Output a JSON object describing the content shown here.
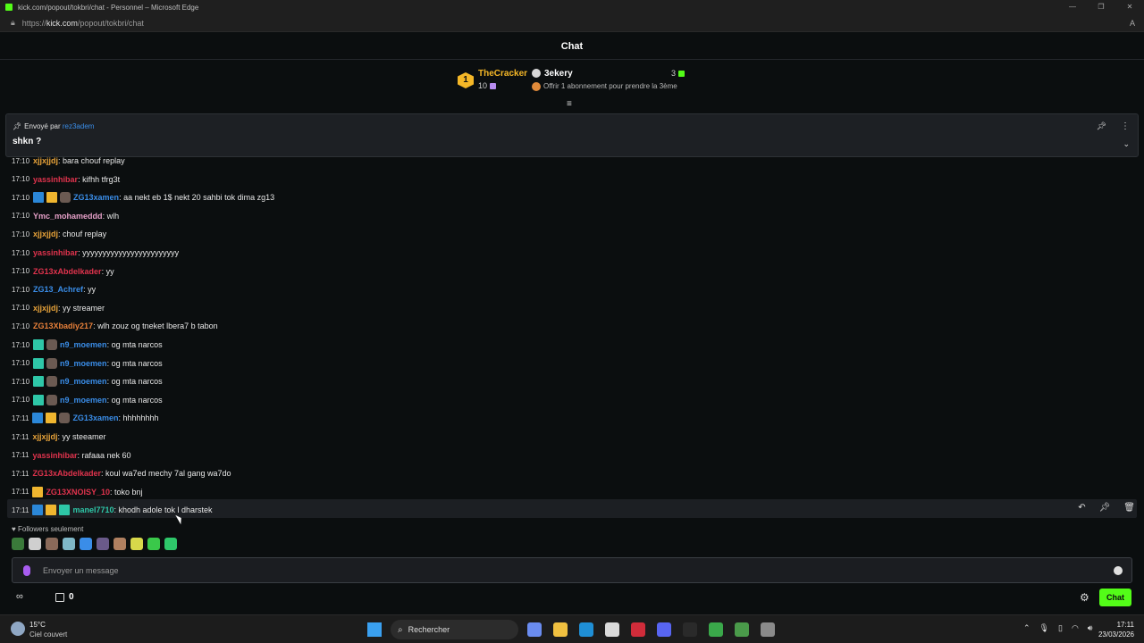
{
  "window": {
    "title": "kick.com/popout/tokbri/chat - Personnel – Microsoft Edge",
    "url_prefix": "https://",
    "url_host": "kick.com",
    "url_path": "/popout/tokbri/chat"
  },
  "header": {
    "title": "Chat"
  },
  "leaderboard": {
    "first": {
      "rank": "1",
      "name": "TheCracker",
      "count": "10"
    },
    "second": {
      "name": "3ekery",
      "count": "3"
    },
    "offer": "Offrir 1 abonnement pour prendre la 3ème"
  },
  "pinned": {
    "prefix": "Envoyé par",
    "sender": "rez3adem",
    "message": "shkn ?"
  },
  "messages": [
    {
      "time": "17:10",
      "badges": [],
      "user": "xjjxjjdj",
      "color": "#e8a33a",
      "text": ": bara chouf replay"
    },
    {
      "time": "17:10",
      "badges": [],
      "user": "yassinhibar",
      "color": "#e0334d",
      "text": ": kifhh tfrg3t"
    },
    {
      "time": "17:10",
      "badges": [
        "sword",
        "crown",
        "avatar"
      ],
      "user": "ZG13xamen",
      "color": "#3a8de8",
      "text": ": aa nekt eb 1$ nekt 20 sahbi tok dima zg13"
    },
    {
      "time": "17:10",
      "badges": [],
      "user": "Ymc_mohameddd",
      "color": "#e6a0c8",
      "text": ": wlh"
    },
    {
      "time": "17:10",
      "badges": [],
      "user": "xjjxjjdj",
      "color": "#e8a33a",
      "text": ": chouf replay"
    },
    {
      "time": "17:10",
      "badges": [],
      "user": "yassinhibar",
      "color": "#e0334d",
      "text": ": yyyyyyyyyyyyyyyyyyyyyyyy"
    },
    {
      "time": "17:10",
      "badges": [],
      "user": "ZG13xAbdelkader",
      "color": "#e0334d",
      "text": ": yy"
    },
    {
      "time": "17:10",
      "badges": [],
      "user": "ZG13_Achref",
      "color": "#3a8de8",
      "text": ": yy"
    },
    {
      "time": "17:10",
      "badges": [],
      "user": "xjjxjjdj",
      "color": "#e8a33a",
      "text": ": yy streamer"
    },
    {
      "time": "17:10",
      "badges": [],
      "user": "ZG13Xbadiy217",
      "color": "#e8803a",
      "text": ": wlh zouz og tneket lbera7 b tabon"
    },
    {
      "time": "17:10",
      "badges": [
        "green",
        "avatar"
      ],
      "user": "n9_moemen",
      "color": "#3a8de8",
      "text": ": og mta narcos"
    },
    {
      "time": "17:10",
      "badges": [
        "green",
        "avatar"
      ],
      "user": "n9_moemen",
      "color": "#3a8de8",
      "text": ": og mta narcos"
    },
    {
      "time": "17:10",
      "badges": [
        "green",
        "avatar"
      ],
      "user": "n9_moemen",
      "color": "#3a8de8",
      "text": ": og mta narcos"
    },
    {
      "time": "17:10",
      "badges": [
        "green",
        "avatar"
      ],
      "user": "n9_moemen",
      "color": "#3a8de8",
      "text": ": og mta narcos"
    },
    {
      "time": "17:11",
      "badges": [
        "sword",
        "crown",
        "avatar"
      ],
      "user": "ZG13xamen",
      "color": "#3a8de8",
      "text": ": hhhhhhhh"
    },
    {
      "time": "17:11",
      "badges": [],
      "user": "xjjxjjdj",
      "color": "#e8a33a",
      "text": ": yy steeamer"
    },
    {
      "time": "17:11",
      "badges": [],
      "user": "yassinhibar",
      "color": "#e0334d",
      "text": ": rafaaa nek 60"
    },
    {
      "time": "17:11",
      "badges": [],
      "user": "ZG13xAbdelkader",
      "color": "#e0334d",
      "text": ": koul wa7ed mechy 7al gang wa7do"
    },
    {
      "time": "17:11",
      "badges": [
        "crown"
      ],
      "user": "ZG13XNOISY_10",
      "color": "#e0334d",
      "text": ": toko bnj"
    },
    {
      "time": "17:11",
      "badges": [
        "sword",
        "crown",
        "green"
      ],
      "user": "manel7710",
      "color": "#2ec7a8",
      "text": ": khodh adole tok l dharstek"
    }
  ],
  "followers_label": "Followers seulement",
  "input": {
    "placeholder": "Envoyer un message"
  },
  "bottom": {
    "infinity": "∞",
    "gift_count": "0",
    "chat_button": "Chat"
  },
  "taskbar": {
    "temp": "15°C",
    "condition": "Ciel couvert",
    "search": "Rechercher",
    "time": "17:11",
    "date": "23/03/2026"
  }
}
